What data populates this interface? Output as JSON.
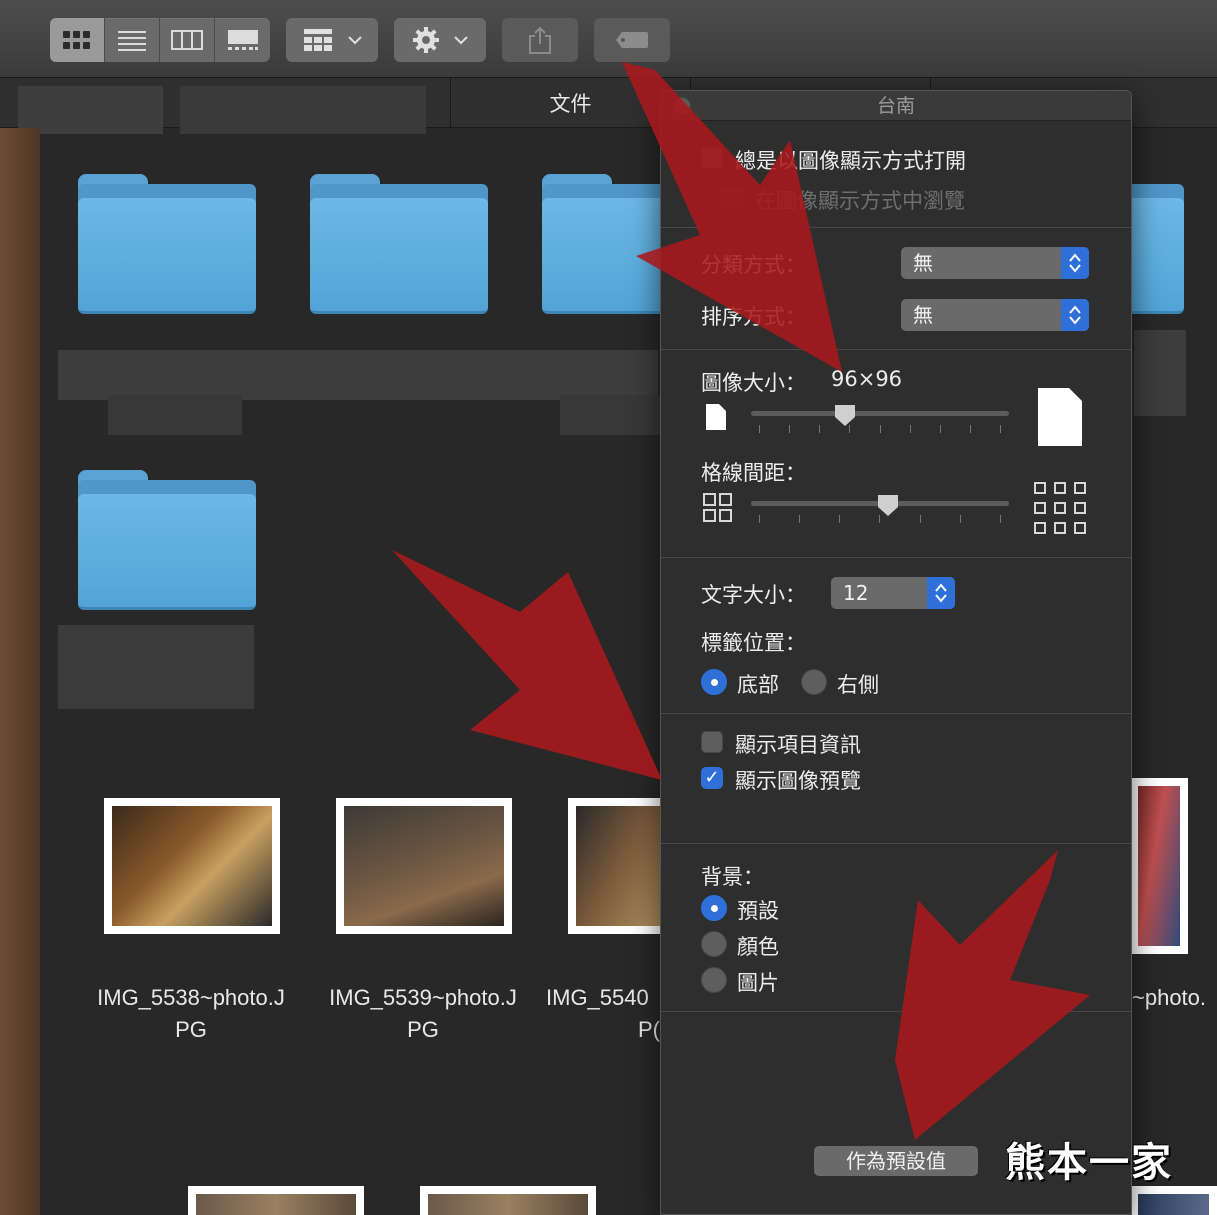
{
  "toolbar": {
    "view_modes": [
      "icon-view",
      "list-view",
      "column-view",
      "gallery-view"
    ],
    "active_view": "icon-view"
  },
  "tabs": {
    "tab1": "文件",
    "tab2": "台南"
  },
  "files": [
    {
      "name_line1": "IMG_5538~photo.J",
      "name_line2": "PG"
    },
    {
      "name_line1": "IMG_5539~photo.J",
      "name_line2": "PG"
    },
    {
      "name_line1": "IMG_5540",
      "name_line2": "P("
    },
    {
      "name_line1": "~photo.",
      "name_line2": ""
    }
  ],
  "panel": {
    "title": "台南",
    "always_open_icon_view": "總是以圖像顯示方式打開",
    "browse_icon_view": "在圖像顯示方式中瀏覽",
    "group_by_label": "分類方式：",
    "group_by_value": "無",
    "sort_by_label": "排序方式：",
    "sort_by_value": "無",
    "icon_size_label": "圖像大小：",
    "icon_size_value": "96×96",
    "grid_spacing_label": "格線間距：",
    "text_size_label": "文字大小：",
    "text_size_value": "12",
    "label_position_label": "標籤位置：",
    "label_bottom": "底部",
    "label_right": "右側",
    "show_item_info": "顯示項目資訊",
    "show_icon_preview": "顯示圖像預覽",
    "background_label": "背景：",
    "bg_default": "預設",
    "bg_color": "顏色",
    "bg_picture": "圖片",
    "use_as_defaults": "作為預設值"
  },
  "states": {
    "always_open_checked": false,
    "show_item_info_checked": false,
    "show_icon_preview_checked": true,
    "label_position": "底部",
    "background": "預設"
  },
  "watermark": "熊本一家",
  "colors": {
    "accent": "#2f6fd8",
    "folder": "#5aa3d3",
    "arrow": "#a8191b"
  }
}
